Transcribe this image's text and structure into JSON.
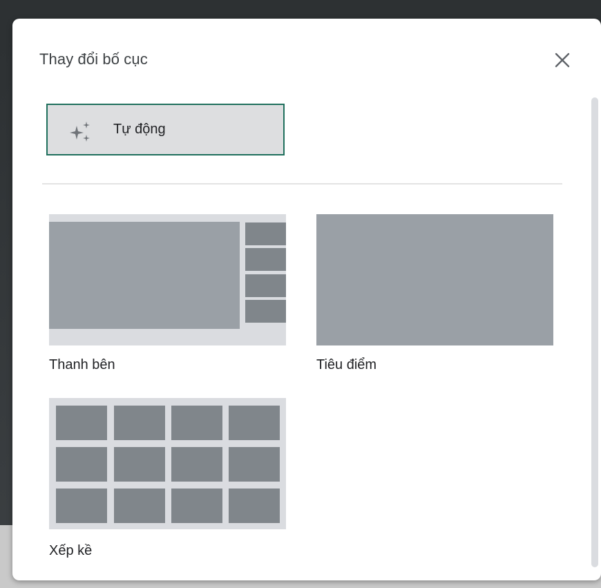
{
  "dialog": {
    "title": "Thay đổi bố cục",
    "close_icon": "close-icon",
    "auto_option": {
      "label": "Tự động",
      "icon": "sparkle-icon",
      "selected": true
    },
    "layouts": [
      {
        "id": "sidebar",
        "label": "Thanh bên",
        "icon": "sidebar-layout-preview"
      },
      {
        "id": "spotlight",
        "label": "Tiêu điểm",
        "icon": "spotlight-layout-preview"
      },
      {
        "id": "tiled",
        "label": "Xếp kề",
        "icon": "tiled-layout-preview"
      }
    ]
  },
  "colors": {
    "selected_border": "#1e6f5c",
    "preview_light": "#dadce0",
    "preview_mid": "#9aa0a6",
    "preview_dark": "#80868b"
  }
}
